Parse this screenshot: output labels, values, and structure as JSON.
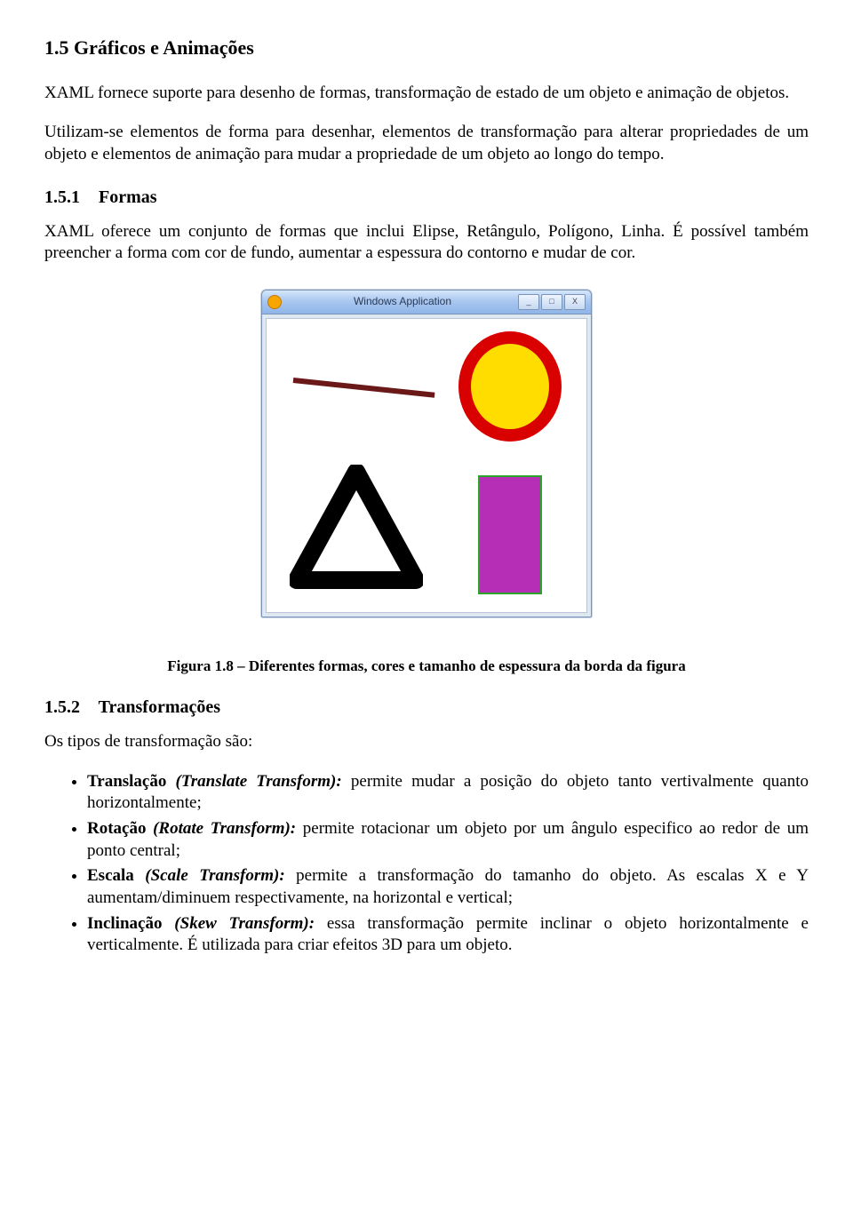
{
  "headings": {
    "h1_5": "1.5 Gráficos e Animações",
    "h1_5_1_num": "1.5.1",
    "h1_5_1_title": "Formas",
    "h1_5_2_num": "1.5.2",
    "h1_5_2_title": "Transformações"
  },
  "paragraphs": {
    "p1": "XAML fornece suporte para desenho de formas, transformação de estado de um objeto e animação de objetos.",
    "p2": "Utilizam-se elementos de forma para desenhar, elementos de transformação para alterar propriedades de um objeto e elementos de animação para mudar a propriedade de um objeto ao longo do tempo.",
    "p3": "XAML oferece um conjunto de formas que inclui Elipse, Retângulo, Polígono, Linha. É possível também preencher a forma com cor de fundo, aumentar a espessura do contorno e mudar de cor.",
    "p4": "Os tipos de transformação são:"
  },
  "figure": {
    "window_title": "Windows Application",
    "btn_min": "_",
    "btn_max": "□",
    "btn_close": "X",
    "caption": "Figura 1.8 – Diferentes formas, cores e tamanho de espessura da borda da figura"
  },
  "bullets": {
    "b1_label": "Translação ",
    "b1_em": "(Translate Transform):",
    "b1_text": " permite mudar a posição do objeto tanto vertivalmente quanto horizontalmente;",
    "b2_label": "Rotação ",
    "b2_em": "(Rotate Transform):",
    "b2_text": " permite rotacionar um objeto por um ângulo especifico ao redor de um ponto central;",
    "b3_label": "Escala ",
    "b3_em": "(Scale Transform):",
    "b3_text": " permite a transformação do tamanho do objeto. As escalas X e Y aumentam/diminuem respectivamente, na horizontal e vertical;",
    "b4_label": "Inclinação ",
    "b4_em": "(Skew Transform):",
    "b4_text": " essa transformação permite inclinar o objeto horizontalmente e verticalmente. É utilizada para criar efeitos 3D para um objeto."
  }
}
